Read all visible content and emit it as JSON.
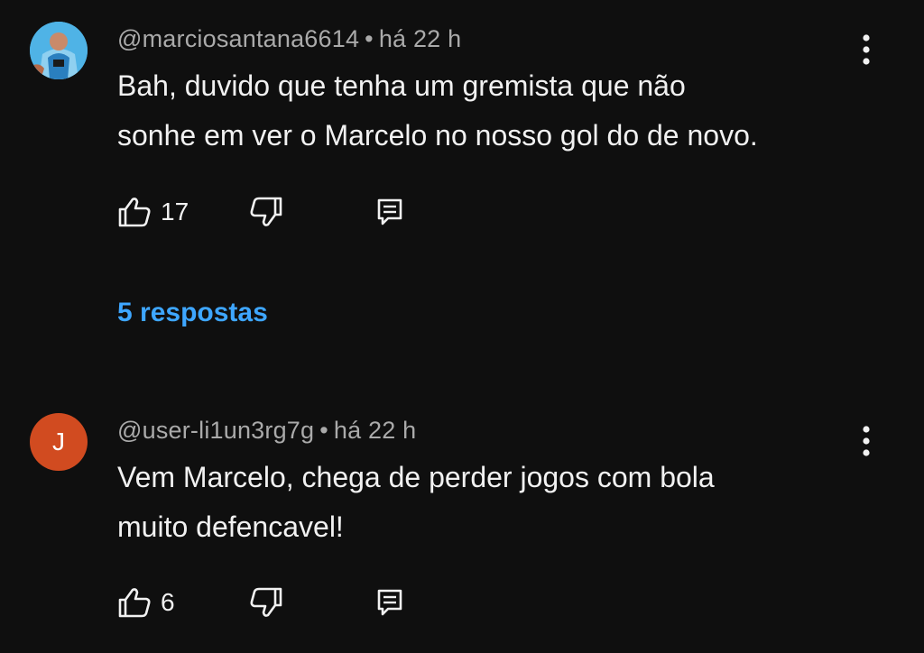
{
  "comments": [
    {
      "avatar_type": "photo",
      "avatar_color": "#3ca6dc",
      "author": "@marciosantana6614",
      "separator": "•",
      "time": "há 22 h",
      "text": "Bah, duvido que tenha um gremista que não\nsonhe em ver o Marcelo no nosso gol do de novo.",
      "likes": "17",
      "replies_label": "5 respostas"
    },
    {
      "avatar_type": "letter",
      "avatar_letter": "J",
      "avatar_color": "#d14b20",
      "author": "@user-li1un3rg7g",
      "separator": "•",
      "time": "há 22 h",
      "text": "Vem Marcelo, chega de perder jogos com bola\nmuito defencavel!",
      "likes": "6"
    }
  ],
  "colors": {
    "background": "#0f0f0f",
    "text": "#f1f1f1",
    "secondary": "#aaaaaa",
    "link": "#3ea6ff"
  },
  "icons": [
    "like-icon",
    "dislike-icon",
    "reply-icon",
    "more-vert-icon"
  ]
}
